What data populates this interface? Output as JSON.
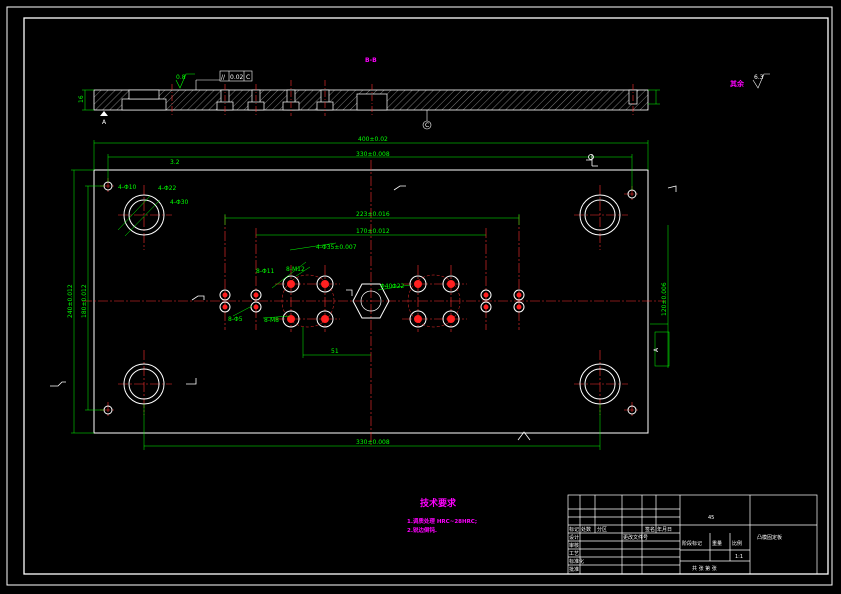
{
  "section": {
    "title": "B-B",
    "thickness": "16",
    "roughness": "0.8",
    "tolerance_frame": {
      "symbol": "//",
      "value": "0.02",
      "datum": "C"
    },
    "datum_a": "A",
    "datum_c": "C"
  },
  "roughness_other": {
    "label": "其余",
    "value": "6.3"
  },
  "dims": {
    "overall_width": "400±0.02",
    "hole_span_top": "330±0.008",
    "hole_span_bottom": "330±0.008",
    "inner_span_1": "223±0.016",
    "inner_span_2": "170±0.012",
    "overall_height": "240±0.012",
    "hole_span_v": "180±0.012",
    "right_v": "120±0.006",
    "offset_51": "51",
    "dia_22_right": "Φ22",
    "dia_40_center": "Φ40",
    "dia_35": "4-Φ35±0.007",
    "dia_10": "4-Φ10",
    "dia_22_corner": "4-Φ22",
    "dia_30": "4-Φ30",
    "m12": "8-Φ11",
    "m10": "8-M12",
    "dia_5": "8-Φ5",
    "m8": "8-M8",
    "view_a": "A",
    "roughness_small": "3.2"
  },
  "tech_req": {
    "title": "技术要求",
    "items": [
      "1.调质处理 HRC~28HRC;",
      "2.锐边倒钝."
    ]
  },
  "title_block": {
    "material_no": "45",
    "part_name": "凸模固定板",
    "scale": "1:1",
    "labels": [
      "标记",
      "处数",
      "分区",
      "更改文件号",
      "签名",
      "年月日",
      "设计",
      "审核",
      "工艺",
      "标准化",
      "批准",
      "阶段标记",
      "重量",
      "比例"
    ],
    "footer": "共 张 第 张"
  }
}
